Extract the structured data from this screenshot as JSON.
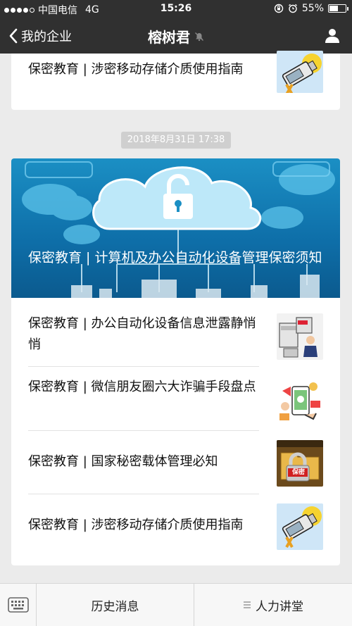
{
  "status_bar": {
    "carrier": "中国电信",
    "network": "4G",
    "time": "15:26",
    "battery": "55%",
    "battery_level": 0.55
  },
  "nav": {
    "back_label": "我的企业",
    "title": "榕树君"
  },
  "top_card": {
    "title": "保密教育 | 涉密移动存储介质使用指南"
  },
  "timestamp": "2018年8月31日 17:38",
  "main_card": {
    "hero_title": "保密教育 | 计算机及办公自动化设备管理保密须知",
    "items": [
      {
        "title": "保密教育 | 办公自动化设备信息泄露静悄悄"
      },
      {
        "title": "保密教育 | 微信朋友圈六大诈骗手段盘点"
      },
      {
        "title": "保密教育 | 国家秘密载体管理必知",
        "thumb_text": "保密"
      },
      {
        "title": "保密教育 | 涉密移动存储介质使用指南"
      }
    ]
  },
  "bottom_bar": {
    "menu_1": "历史消息",
    "menu_2": "人力讲堂"
  }
}
